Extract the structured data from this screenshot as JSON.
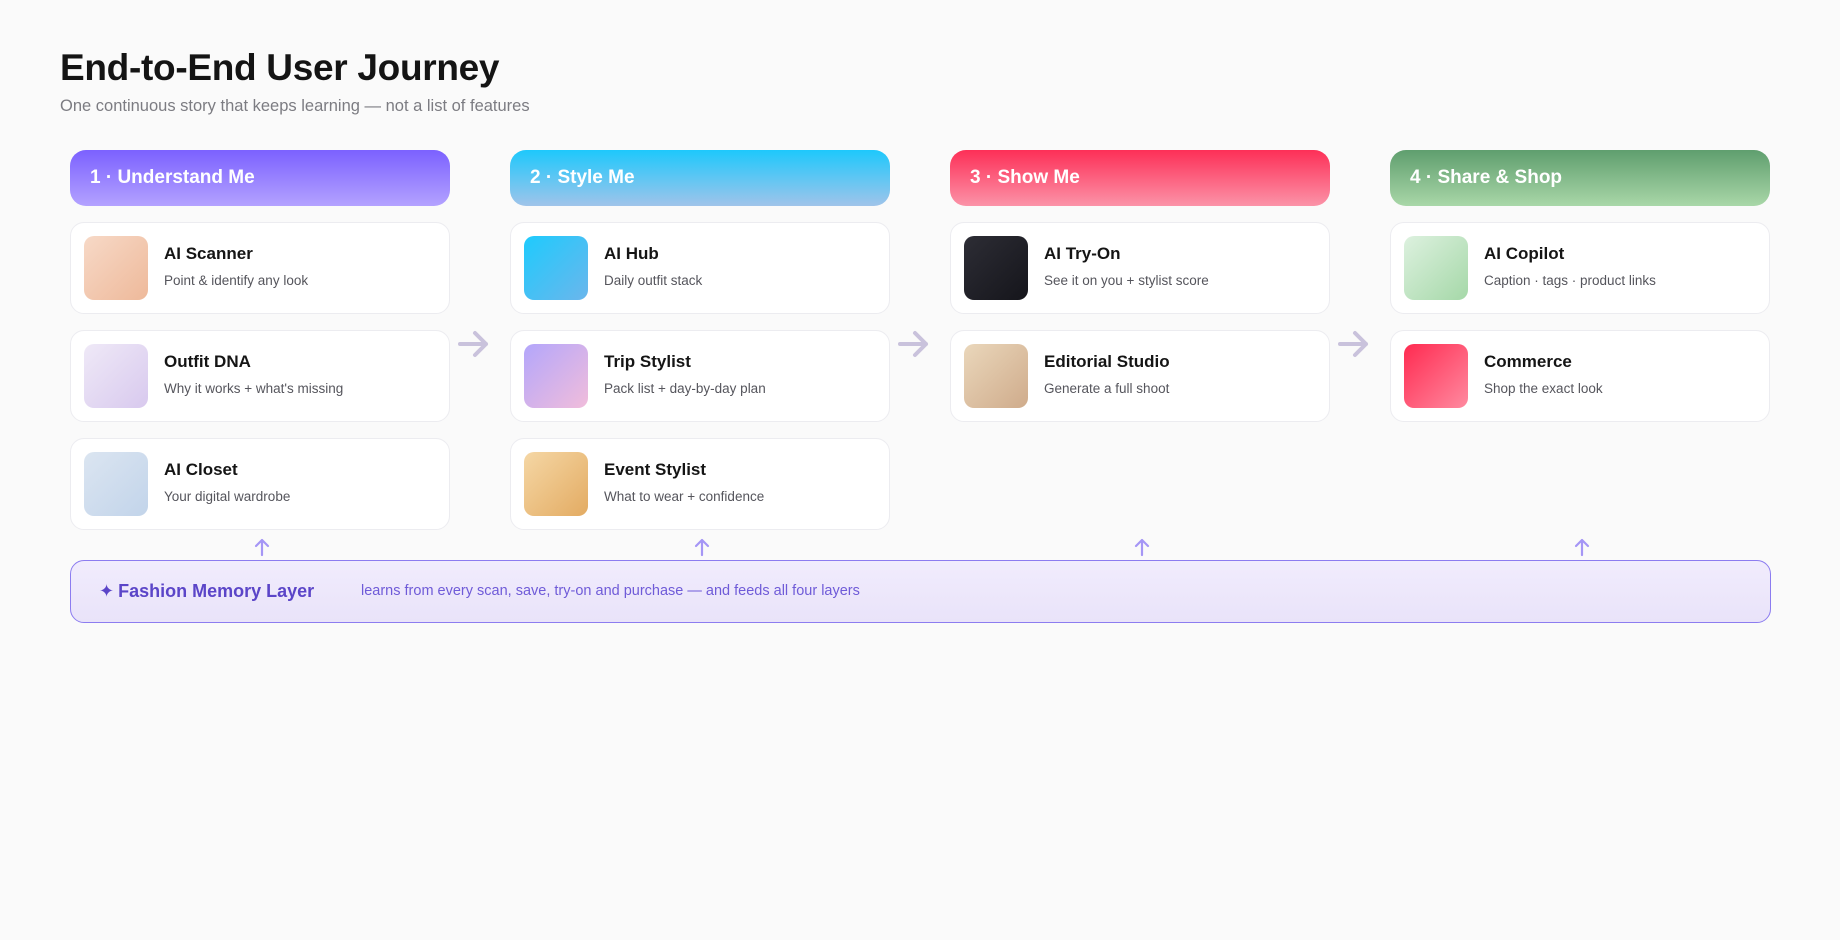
{
  "header": {
    "title": "End-to-End User Journey",
    "subtitle": "One continuous story that keeps learning — not a list of features"
  },
  "columns": [
    {
      "label": "1 · Understand Me",
      "gradient": [
        "#7b61ff",
        "#b3a2ff"
      ],
      "cards": [
        {
          "title": "AI Scanner",
          "desc": "Point & identify any look",
          "thumb": [
            "#f7d9c7",
            "#eeb99a"
          ]
        },
        {
          "title": "Outfit DNA",
          "desc": "Why it works + what's missing",
          "thumb": [
            "#efe9f7",
            "#d8c9ee"
          ]
        },
        {
          "title": "AI Closet",
          "desc": "Your digital wardrobe",
          "thumb": [
            "#dbe5f1",
            "#c2d4ea"
          ]
        }
      ]
    },
    {
      "label": "2 · Style Me",
      "gradient": [
        "#1ec8fc",
        "#a0c4ea"
      ],
      "cards": [
        {
          "title": "AI Hub",
          "desc": "Daily outfit stack",
          "thumb": [
            "#1ecbfd",
            "#6bb6ec"
          ]
        },
        {
          "title": "Trip Stylist",
          "desc": "Pack list + day-by-day plan",
          "thumb": [
            "#b3a6fb",
            "#f1bddb"
          ]
        },
        {
          "title": "Event Stylist",
          "desc": "What to wear + confidence",
          "thumb": [
            "#f5d7a5",
            "#e3ab62"
          ]
        }
      ]
    },
    {
      "label": "3 · Show Me",
      "gradient": [
        "#fd2f57",
        "#fb93a8"
      ],
      "cards": [
        {
          "title": "AI Try-On",
          "desc": "See it on you + stylist score",
          "thumb": [
            "#2d2d35",
            "#15151b"
          ]
        },
        {
          "title": "Editorial Studio",
          "desc": "Generate a full shoot",
          "thumb": [
            "#ead7bb",
            "#cfab8b"
          ]
        }
      ]
    },
    {
      "label": "4 · Share & Shop",
      "gradient": [
        "#5f9e6e",
        "#a9d7a8"
      ],
      "cards": [
        {
          "title": "AI Copilot",
          "desc": "Caption · tags · product links",
          "thumb": [
            "#ddf1df",
            "#a5d8a8"
          ]
        },
        {
          "title": "Commerce",
          "desc": "Shop the exact look",
          "thumb": [
            "#ff2a50",
            "#ff8aa0"
          ]
        }
      ]
    }
  ],
  "memory_layer": {
    "title": "Fashion Memory Layer",
    "star": "✦",
    "desc": "learns from every scan, save, try-on and purchase — and feeds all four layers"
  },
  "colors": {
    "flow_arrow": "#c9c2dc",
    "up_arrow": "#a596f5"
  }
}
